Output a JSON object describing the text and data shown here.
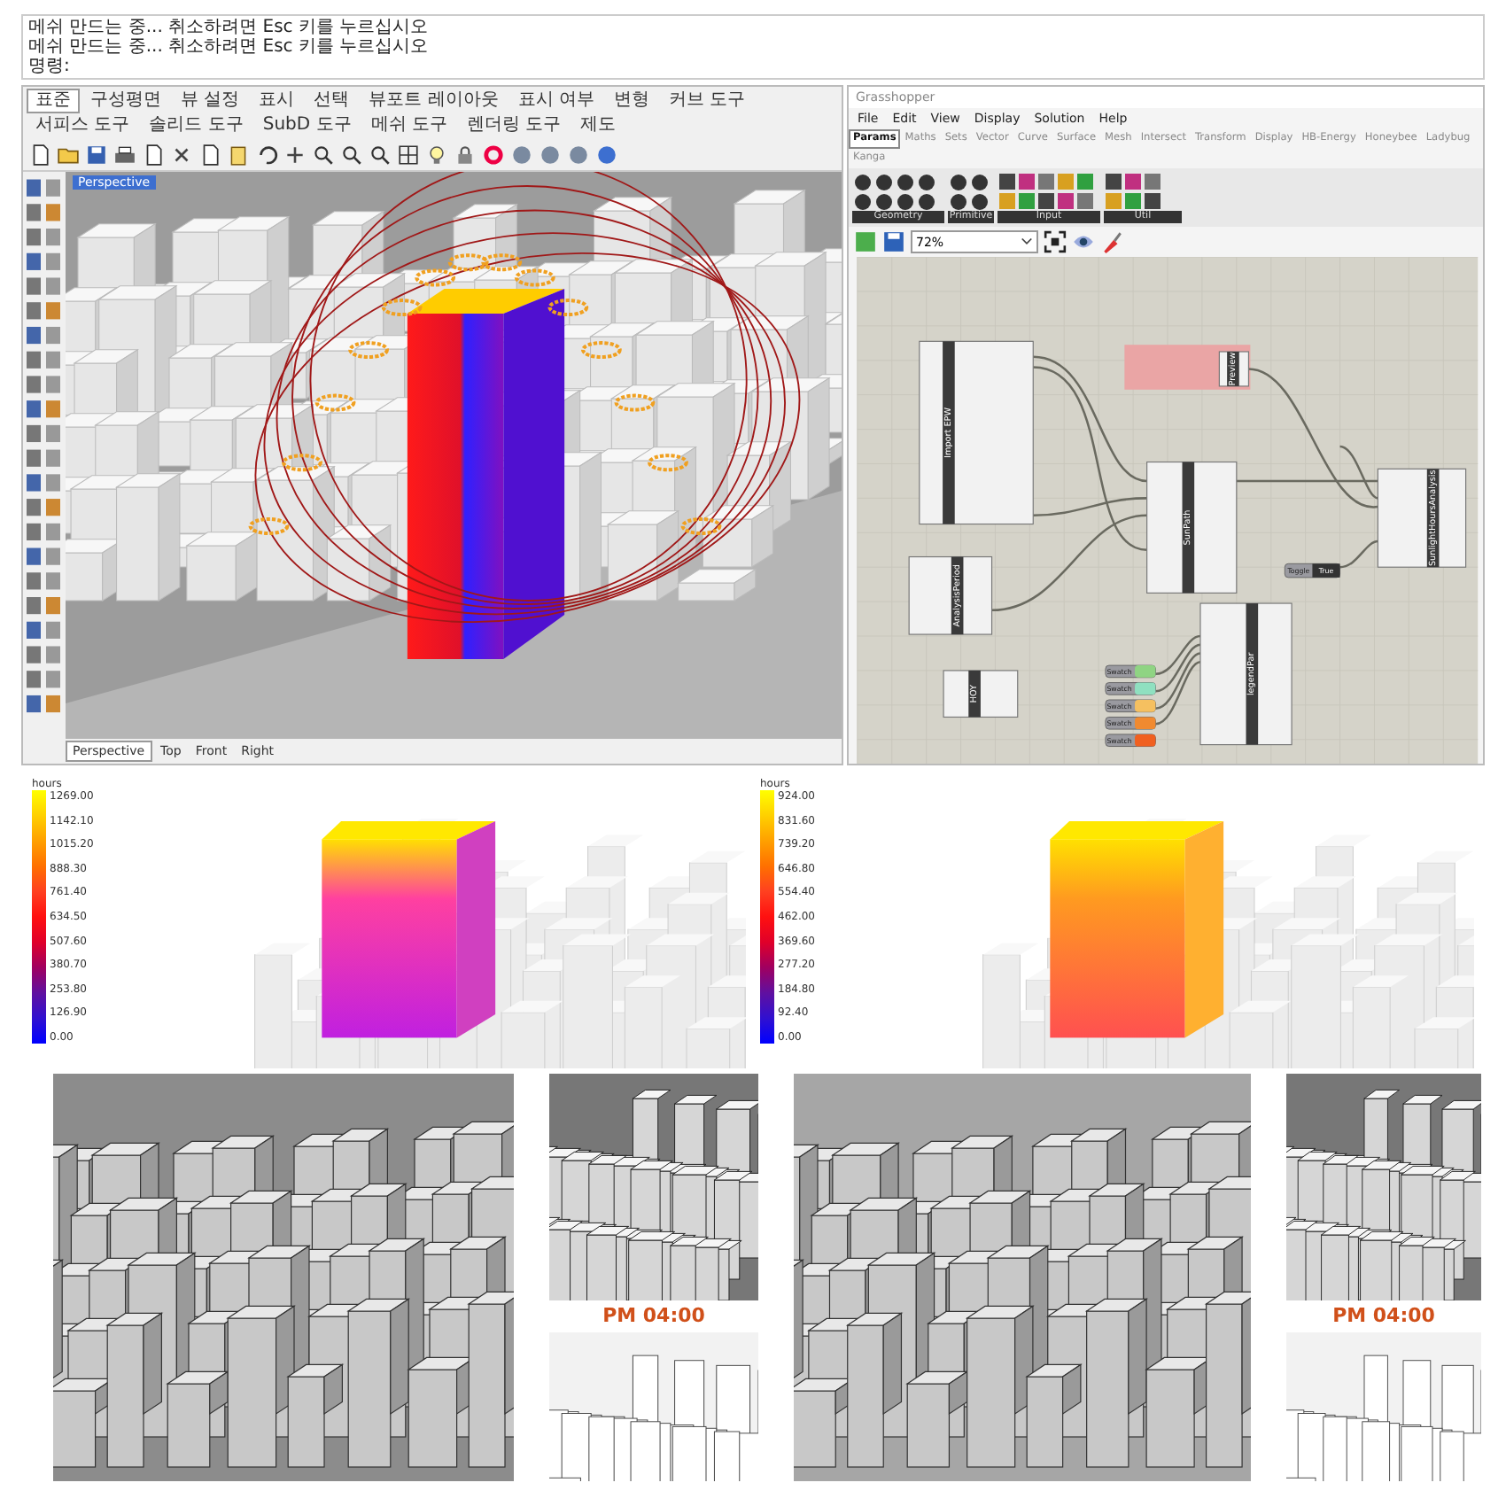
{
  "command_history": {
    "lines": [
      "메쉬 만드는 중... 취소하려면 Esc 키를 누르십시오",
      "메쉬 만드는 중... 취소하려면 Esc 키를 누르십시오"
    ],
    "prompt": "명령:"
  },
  "rhino": {
    "tabs": [
      {
        "label": "표준",
        "selected": true
      },
      {
        "label": "구성평면",
        "selected": false
      },
      {
        "label": "뷰 설정",
        "selected": false
      },
      {
        "label": "표시",
        "selected": false
      },
      {
        "label": "선택",
        "selected": false
      },
      {
        "label": "뷰포트 레이아웃",
        "selected": false
      },
      {
        "label": "표시 여부",
        "selected": false
      },
      {
        "label": "변형",
        "selected": false
      },
      {
        "label": "커브 도구",
        "selected": false
      },
      {
        "label": "서피스 도구",
        "selected": false
      },
      {
        "label": "솔리드 도구",
        "selected": false
      },
      {
        "label": "SubD 도구",
        "selected": false
      },
      {
        "label": "메쉬 도구",
        "selected": false
      },
      {
        "label": "렌더링 도구",
        "selected": false
      },
      {
        "label": "제도",
        "selected": false
      }
    ],
    "viewport_label": "Perspective",
    "view_tabs": [
      {
        "label": "Perspective",
        "selected": true
      },
      {
        "label": "Top",
        "selected": false
      },
      {
        "label": "Front",
        "selected": false
      },
      {
        "label": "Right",
        "selected": false
      }
    ]
  },
  "grasshopper": {
    "title": "Grasshopper",
    "menus": [
      "File",
      "Edit",
      "View",
      "Display",
      "Solution",
      "Help"
    ],
    "tabs": [
      {
        "label": "Params",
        "selected": true
      },
      {
        "label": "Maths",
        "selected": false
      },
      {
        "label": "Sets",
        "selected": false
      },
      {
        "label": "Vector",
        "selected": false
      },
      {
        "label": "Curve",
        "selected": false
      },
      {
        "label": "Surface",
        "selected": false
      },
      {
        "label": "Mesh",
        "selected": false
      },
      {
        "label": "Intersect",
        "selected": false
      },
      {
        "label": "Transform",
        "selected": false
      },
      {
        "label": "Display",
        "selected": false
      },
      {
        "label": "HB-Energy",
        "selected": false
      },
      {
        "label": "Honeybee",
        "selected": false
      },
      {
        "label": "Ladybug",
        "selected": false
      },
      {
        "label": "Kanga",
        "selected": false
      }
    ],
    "groups": [
      "Geometry",
      "Primitive",
      "Input",
      "Util"
    ],
    "zoom": "72%",
    "components": [
      "Import EPW",
      "SunPath",
      "AnalysisPeriod",
      "HOY",
      "legendPar",
      "SunlightHoursAnalysis",
      "Preview"
    ],
    "toggle": {
      "label": "Toggle",
      "value": "True"
    },
    "swatches": [
      {
        "label": "Swatch",
        "color": "#8fd483"
      },
      {
        "label": "Swatch",
        "color": "#8fe0c0"
      },
      {
        "label": "Swatch",
        "color": "#f5c060"
      },
      {
        "label": "Swatch",
        "color": "#f08a30"
      },
      {
        "label": "Swatch",
        "color": "#f06020"
      }
    ]
  },
  "results": [
    {
      "title": "hours",
      "values": [
        "1269.00",
        "1142.10",
        "1015.20",
        "888.30",
        "761.40",
        "634.50",
        "507.60",
        "380.70",
        "253.80",
        "126.90",
        "0.00"
      ]
    },
    {
      "title": "hours",
      "values": [
        "924.00",
        "831.60",
        "739.20",
        "646.80",
        "554.40",
        "462.00",
        "369.60",
        "277.20",
        "184.80",
        "92.40",
        "0.00"
      ]
    }
  ],
  "shadow_captions": [
    "PM 04:00",
    "PM 04:00"
  ]
}
